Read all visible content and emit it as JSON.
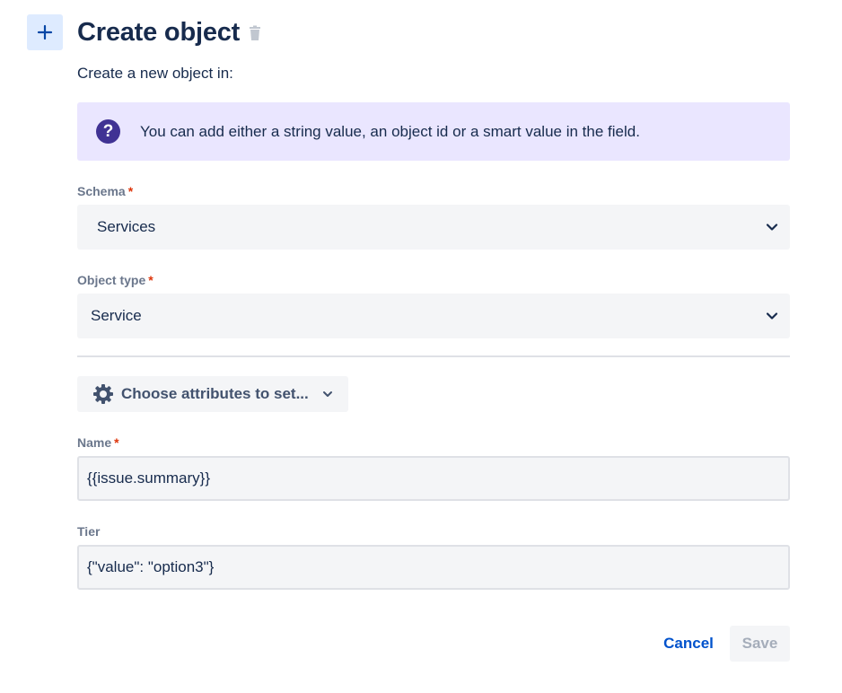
{
  "header": {
    "add_icon": "plus-icon",
    "title": "Create object",
    "delete_icon": "trash-icon"
  },
  "subtitle": "Create a new object in:",
  "info_banner": {
    "icon": "question-circle-icon",
    "icon_glyph": "?",
    "text": "You can add either a string value, an object id or a smart value in the field."
  },
  "schema": {
    "label": "Schema",
    "required_mark": "*",
    "value": "Services",
    "icon": "chevron-down-icon"
  },
  "object_type": {
    "label": "Object type",
    "required_mark": "*",
    "value": "Service",
    "icon": "chevron-down-icon"
  },
  "attributes_button": {
    "icon": "gear-icon",
    "label": "Choose attributes to set...",
    "chevron_icon": "chevron-down-icon"
  },
  "name_field": {
    "label": "Name",
    "required_mark": "*",
    "value": "{{issue.summary}}"
  },
  "tier_field": {
    "label": "Tier",
    "value": "{\"value\": \"option3\"}"
  },
  "footer": {
    "cancel_label": "Cancel",
    "save_label": "Save"
  },
  "colors": {
    "info_background": "#eae6ff",
    "info_icon": "#403294",
    "link": "#0052cc",
    "required": "#de350b",
    "field_background": "#f4f5f7"
  }
}
